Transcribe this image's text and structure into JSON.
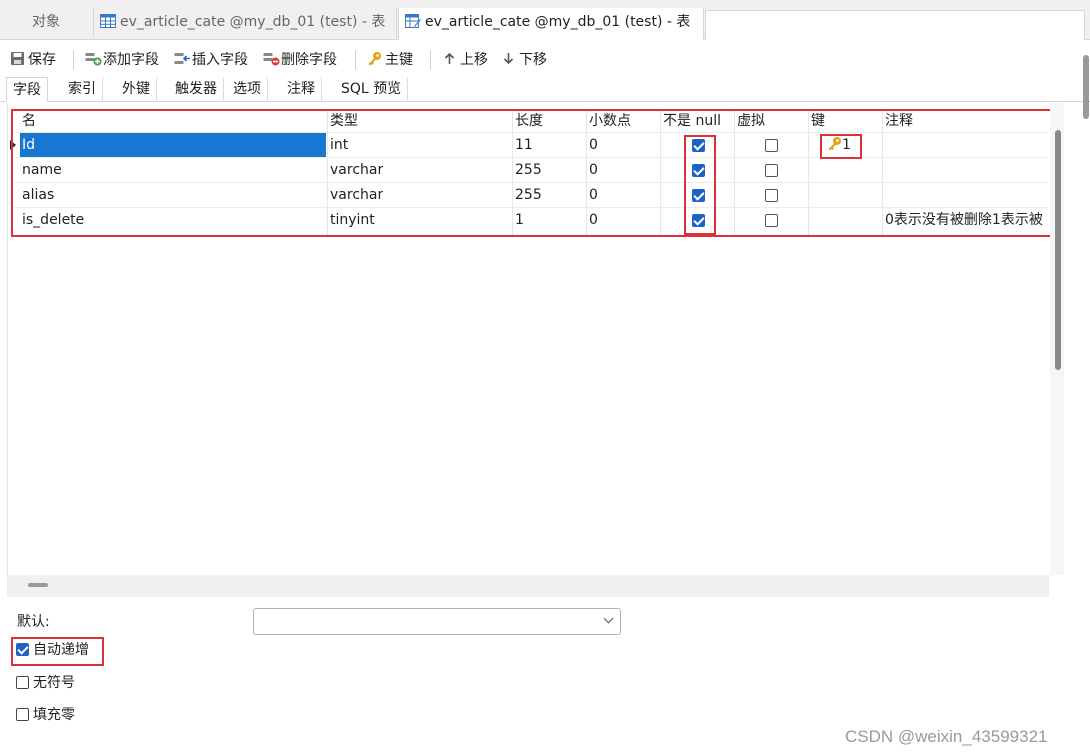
{
  "tabs": [
    {
      "label": "对象"
    },
    {
      "label": "ev_article_cate @my_db_01 (test) - 表",
      "icon": "table-icon"
    },
    {
      "label": "ev_article_cate @my_db_01 (test) - 表",
      "icon": "table-design-icon"
    }
  ],
  "toolbar": {
    "save": "保存",
    "add_field": "添加字段",
    "insert_field": "插入字段",
    "delete_field": "删除字段",
    "primary_key": "主键",
    "move_up": "上移",
    "move_down": "下移"
  },
  "subtabs": [
    "字段",
    "索引",
    "外键",
    "触发器",
    "选项",
    "注释",
    "SQL 预览"
  ],
  "columns": [
    "名",
    "类型",
    "长度",
    "小数点",
    "不是 null",
    "虚拟",
    "键",
    "注释"
  ],
  "rows": [
    {
      "name": "Id",
      "type": "int",
      "length": "11",
      "decimals": "0",
      "not_null": true,
      "virtual": false,
      "key": "1",
      "comment": ""
    },
    {
      "name": "name",
      "type": "varchar",
      "length": "255",
      "decimals": "0",
      "not_null": true,
      "virtual": false,
      "key": "",
      "comment": ""
    },
    {
      "name": "alias",
      "type": "varchar",
      "length": "255",
      "decimals": "0",
      "not_null": true,
      "virtual": false,
      "key": "",
      "comment": ""
    },
    {
      "name": "is_delete",
      "type": "tinyint",
      "length": "1",
      "decimals": "0",
      "not_null": true,
      "virtual": false,
      "key": "",
      "comment": "0表示没有被删除1表示被"
    }
  ],
  "props": {
    "default_label": "默认:",
    "default_value": "",
    "auto_increment": {
      "label": "自动递增",
      "checked": true
    },
    "unsigned": {
      "label": "无符号",
      "checked": false
    },
    "zerofill": {
      "label": "填充零",
      "checked": false
    }
  },
  "watermark": "CSDN @weixin_43599321",
  "colors": {
    "selection": "#1777d1",
    "highlight": "#e0303a",
    "checkbox": "#1c63c7"
  }
}
